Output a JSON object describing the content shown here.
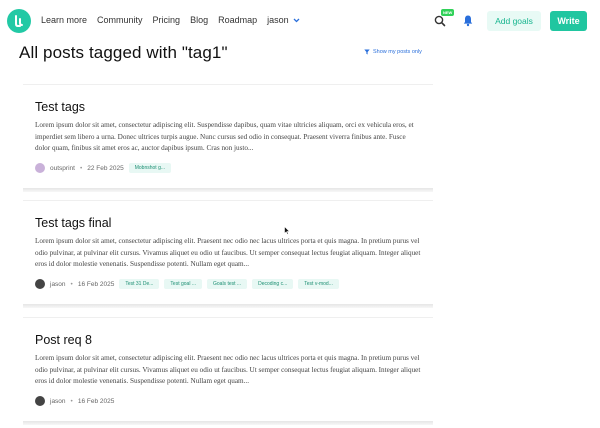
{
  "nav": {
    "items": [
      "Learn more",
      "Community",
      "Pricing",
      "Blog",
      "Roadmap"
    ],
    "user": "jason"
  },
  "header_actions": {
    "new_badge": "NEW",
    "add_goals": "Add goals",
    "write": "Write"
  },
  "page": {
    "title": "All posts tagged with \"tag1\"",
    "filter_link": "Show my posts only"
  },
  "posts": [
    {
      "title": "Test tags",
      "excerpt": "Lorem ipsum dolor sit amet, consectetur adipiscing elit. Suspendisse dapibus, quam vitae ultricies aliquam, orci ex vehicula eros, et imperdiet sem libero a urna. Donec ultrices turpis augue. Nunc cursus sed odio in consequat. Praesent viverra finibus ante. Fusce dolor quam, finibus sit amet eros ac, auctor dapibus ipsum. Cras non justo...",
      "author": "outsprint",
      "date": "22 Feb 2025",
      "tags": [
        "Mobnshot g..."
      ]
    },
    {
      "title": "Test tags final",
      "excerpt": "Lorem ipsum dolor sit amet, consectetur adipiscing elit. Praesent nec odio nec lacus ultrices porta et quis magna. In pretium purus vel odio pulvinar, at pulvinar elit cursus. Vivamus aliquet eu odio ut faucibus. Ut semper consequat lectus feugiat aliquam. Integer aliquet eros id dolor molestie venenatis. Suspendisse potenti. Nullam eget quam...",
      "author": "jason",
      "date": "16 Feb 2025",
      "tags": [
        "Test 31 De...",
        "Test goal ...",
        "Goals test ...",
        "Decoding c...",
        "Test v-mod..."
      ]
    },
    {
      "title": "Post req 8",
      "excerpt": "Lorem ipsum dolor sit amet, consectetur adipiscing elit. Praesent nec odio nec lacus ultrices porta et quis magna. In pretium purus vel odio pulvinar, at pulvinar elit cursus. Vivamus aliquet eu odio ut faucibus. Ut semper consequat lectus feugiat aliquam. Integer aliquet eros id dolor molestie venenatis. Suspendisse potenti. Nullam eget quam...",
      "author": "jason",
      "date": "16 Feb 2025",
      "tags": []
    }
  ],
  "icons": {
    "logo": "logo-icon",
    "search": "search-icon",
    "bell": "bell-icon",
    "filter": "filter-icon",
    "chevron": "chevron-down-icon",
    "cursor": "mouse-cursor-icon"
  },
  "colors": {
    "brand": "#20c6a0",
    "add_goals_bg": "#e8faf5",
    "link": "#2a6fdb",
    "new_badge": "#30d158",
    "tag_bg": "#e8f8f4"
  }
}
